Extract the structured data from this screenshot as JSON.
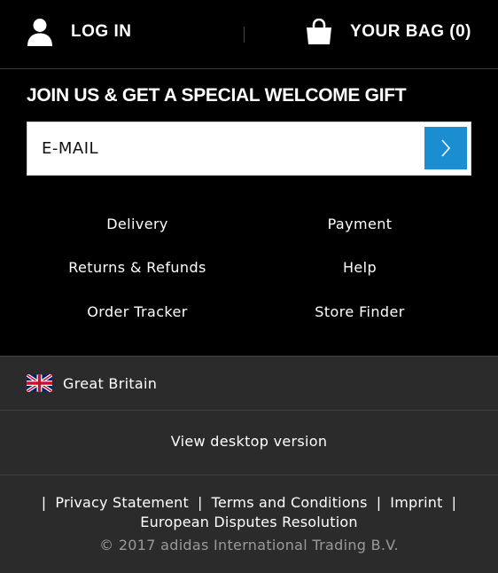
{
  "header": {
    "login_label": "LOG IN",
    "bag_label": "YOUR BAG (0)",
    "login_icon": "user-icon",
    "bag_icon": "shopping-bag-icon"
  },
  "newsletter": {
    "heading": "JOIN US & GET A SPECIAL WELCOME GIFT",
    "email_placeholder": "E-MAIL",
    "submit_icon": "chevron-right-icon",
    "accent_color": "#1b8ed2"
  },
  "footer_links": {
    "delivery": "Delivery",
    "payment": "Payment",
    "returns": "Returns & Refunds",
    "help": "Help",
    "order_tracker": "Order Tracker",
    "store_finder": "Store Finder"
  },
  "country": {
    "label": "Great Britain",
    "flag_icon": "uk-flag-icon"
  },
  "desktop_link": "View desktop version",
  "legal": {
    "privacy": "Privacy Statement",
    "terms": "Terms and Conditions",
    "imprint": "Imprint",
    "disputes": "European Disputes Resolution",
    "separator": "|"
  },
  "copyright": "© 2017 adidas International Trading B.V."
}
